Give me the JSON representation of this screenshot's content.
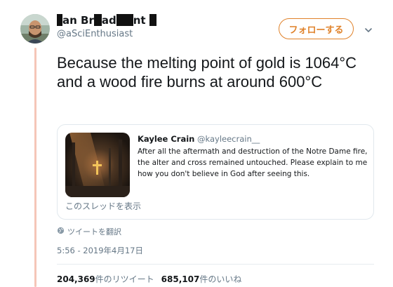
{
  "author": {
    "name_parts": [
      "",
      "an Br",
      "",
      "ad",
      "",
      "nt",
      ""
    ],
    "handle": "@aSciEnthusiast"
  },
  "follow_button": {
    "label": "フォローする"
  },
  "tweet": {
    "text": "Because the melting point of gold is 1064°C and a wood fire burns at around 600°C"
  },
  "quoted_tweet": {
    "name": "Kaylee Crain",
    "handle": "@kayleecrain__",
    "text": "After all the aftermath and destruction of the Notre Dame fire, the alter and cross remained untouched. Please explain to me how you don't believe in God after seeing this.",
    "thread_link": "このスレッドを表示"
  },
  "translate_link": "ツイートを翻訳",
  "timestamp": "5:56 - 2019年4月17日",
  "stats": {
    "retweets_count": "204,369",
    "retweets_label": "件のリツイート",
    "likes_count": "685,107",
    "likes_label": "件のいいね"
  },
  "colors": {
    "accent": "#e0822a",
    "thread_line": "#f5c6b8",
    "secondary_text": "#657786",
    "border": "#e1e8ed"
  },
  "icons": [
    "avatar",
    "chevron-down-icon",
    "globe-icon",
    "cross-image"
  ]
}
